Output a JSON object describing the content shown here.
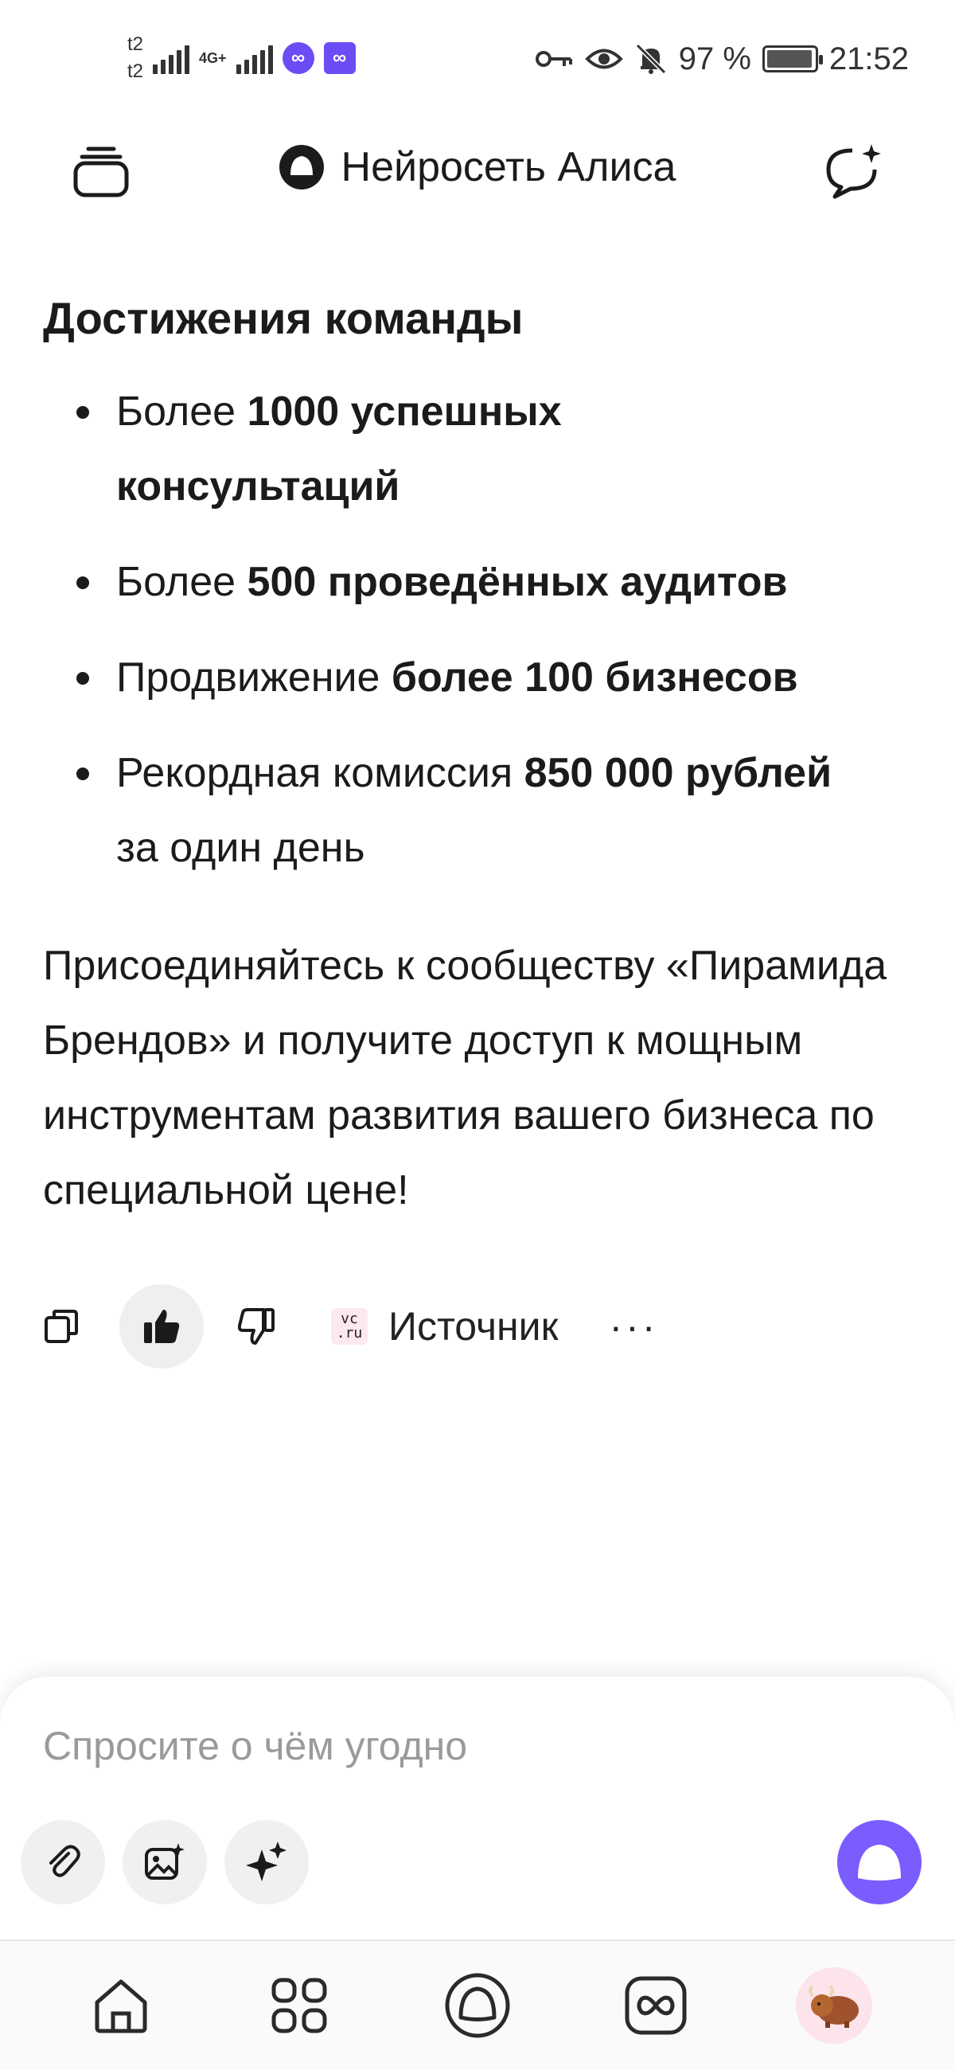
{
  "status_bar": {
    "carrier_1": "t2",
    "carrier_2": "t2",
    "network_type": "4G+",
    "battery_percent": "97 %",
    "battery_level": 0.97,
    "time": "21:52"
  },
  "header": {
    "title": "Нейросеть Алиса"
  },
  "content": {
    "heading": "Достижения команды",
    "bullets": [
      {
        "prefix": "Более ",
        "bold": "1000 успешных консультаций",
        "suffix": ""
      },
      {
        "prefix": "Более ",
        "bold": "500 проведённых аудитов",
        "suffix": ""
      },
      {
        "prefix": "Продвижение ",
        "bold": "более 100 бизнесов",
        "suffix": ""
      },
      {
        "prefix": "Рекордная комиссия ",
        "bold": "850 000 рублей",
        "suffix": " за один день"
      }
    ],
    "paragraph": "Присоединяйтесь к сообществу «Пирамида Брендов» и получите доступ к мощным инструментам развития вашего бизнеса по специальной цене!"
  },
  "actions": {
    "source_label": "Источник",
    "source_logo_line1": "vc",
    "source_logo_line2": ".ru",
    "more_label": "···"
  },
  "input": {
    "placeholder": "Спросите о чём угодно"
  },
  "icons": {
    "accent": "#7b5cff"
  }
}
